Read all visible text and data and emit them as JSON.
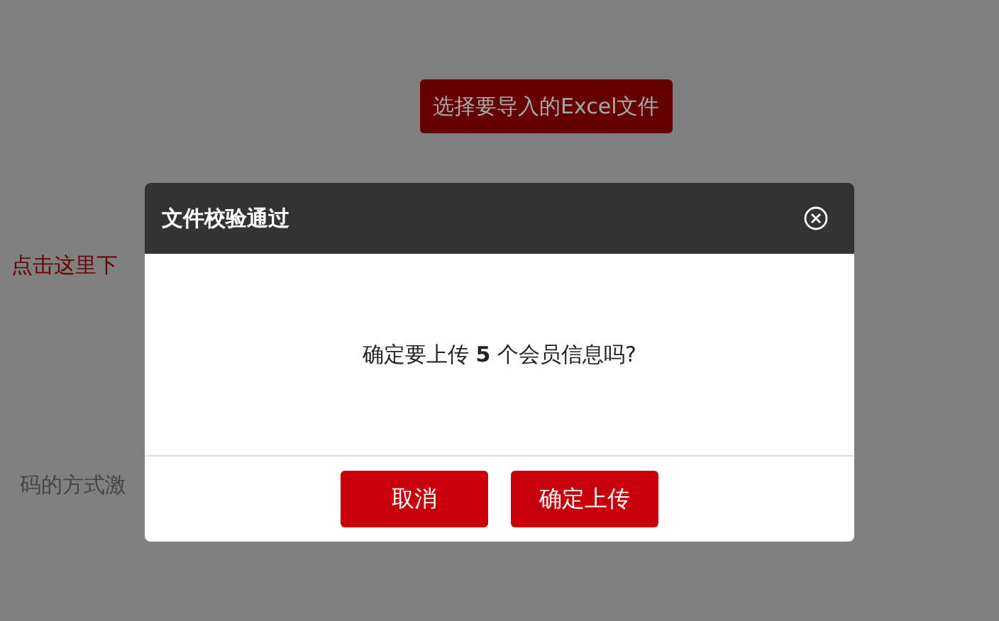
{
  "page": {
    "select_button": "选择要导入的Excel文件",
    "download_link": "点击这里下",
    "activation_text": "码的方式激"
  },
  "dialog": {
    "title": "文件校验通过",
    "message": "确定要上传 **5** 个会员信息吗?",
    "buttons": [
      {
        "label": "取消"
      },
      {
        "label": "确定上传"
      }
    ]
  }
}
